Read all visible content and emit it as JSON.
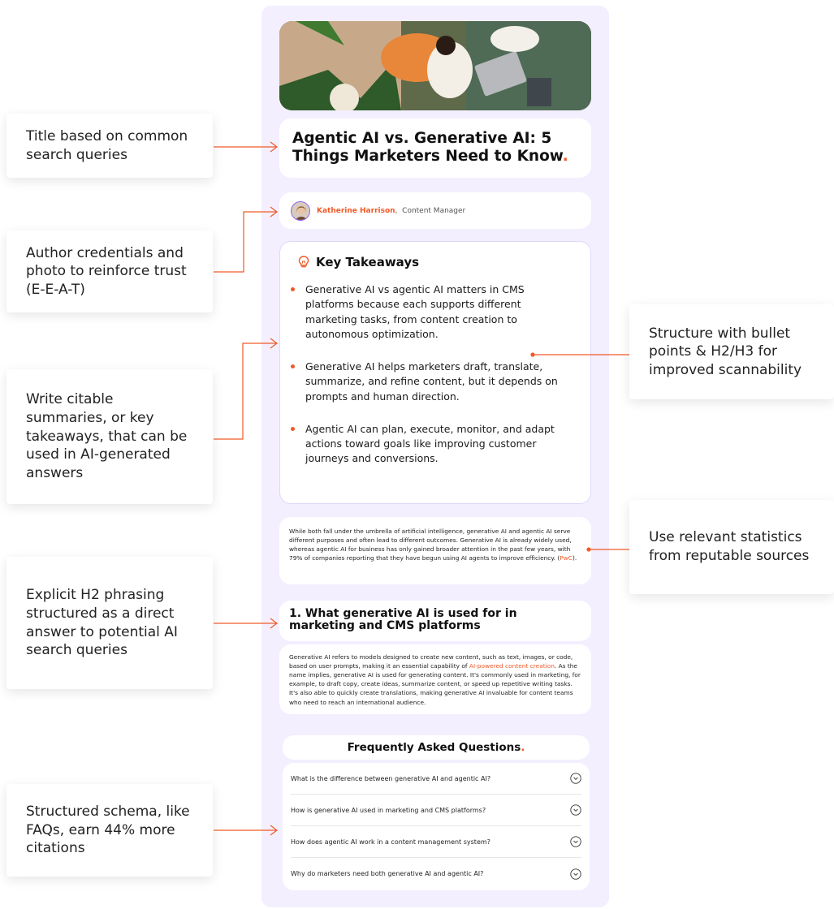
{
  "annotations": {
    "title": "Title based on common search queries",
    "author": "Author credentials and photo to reinforce trust (E-E-A-T)",
    "summaries": "Write citable summaries, or key takeaways, that can be used in AI-generated answers",
    "h2": "Explicit H2 phrasing structured as a direct answer to potential AI search queries",
    "schema": "Structured schema, like FAQs, earn 44% more citations",
    "structure": "Structure with bullet points & H2/H3 for improved scannability",
    "stats": "Use relevant statistics from reputable sources"
  },
  "article": {
    "title": "Agentic AI vs. Generative AI: 5 Things Marketers Need to Know",
    "title_accent": ".",
    "author_name": "Katherine Harrison",
    "author_sep": ",",
    "author_role": "Content Manager",
    "takeaways_heading": "Key Takeaways",
    "takeaways": [
      "Generative AI vs agentic AI matters in CMS platforms because each supports different marketing tasks, from content creation to autonomous optimization.",
      "Generative AI helps marketers draft, translate, summarize, and refine content, but it depends on prompts and human direction.",
      "Agentic AI can plan, execute, monitor, and adapt actions toward goals like improving customer journeys and conversions."
    ],
    "intro_text": "While both fall under the umbrella of artificial intelligence, generative AI and agentic AI serve different purposes and often lead to different outcomes. Generative AI is already widely used, whereas agentic AI for business has only gained broader attention in the past few years, with 79% of companies reporting that they have begun using AI agents to improve efficiency. (",
    "intro_link": "PwC",
    "intro_end": ").",
    "h2": "1. What generative AI is used for in marketing and CMS platforms",
    "body_start": "Generative AI refers to models designed to create new content, such as text, images, or code, based on user prompts, making it an essential capability of ",
    "body_link": "AI-powered content creation",
    "body_end": ".  As the name implies, generative AI is used for generating content. It's commonly used in marketing, for example, to draft copy, create ideas, summarize content, or speed up repetitive writing tasks. It's also able to quickly create translations, making generative AI invaluable for content teams who need to reach an international audience.",
    "faq_title": "Frequently Asked Questions",
    "faq_accent": ".",
    "faqs": [
      "What is the difference between generative AI and agentic AI?",
      "How is generative AI used in marketing and CMS platforms?",
      "How does agentic AI work in a content management system?",
      "Why do marketers need both generative AI and agentic AI?"
    ]
  },
  "colors": {
    "accent": "#f05a28",
    "column_bg": "#f3efff",
    "avatar_ring": "#8a5cf0"
  },
  "icons": {
    "takeaways": "lightbulb-icon",
    "faq_toggle": "chevron-down-icon"
  }
}
